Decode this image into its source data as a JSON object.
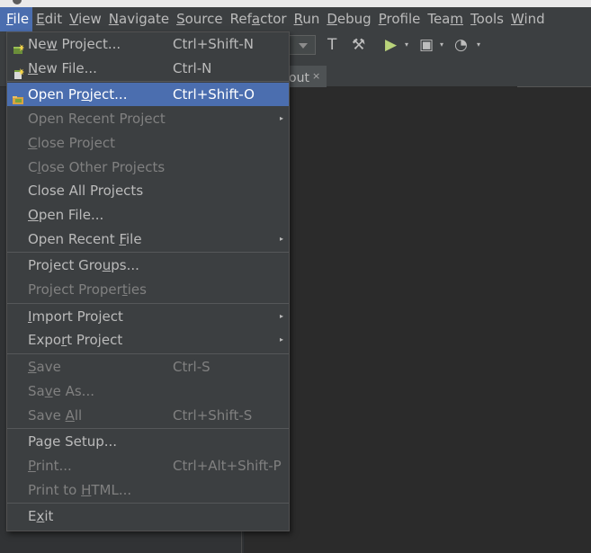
{
  "menubar": [
    {
      "label": "File",
      "m": 0,
      "active": true
    },
    {
      "label": "Edit",
      "m": 0
    },
    {
      "label": "View",
      "m": 0
    },
    {
      "label": "Navigate",
      "m": 0
    },
    {
      "label": "Source",
      "m": 0
    },
    {
      "label": "Refactor",
      "m": 3
    },
    {
      "label": "Run",
      "m": 0
    },
    {
      "label": "Debug",
      "m": 0
    },
    {
      "label": "Profile",
      "m": 0
    },
    {
      "label": "Team",
      "m": 3
    },
    {
      "label": "Tools",
      "m": 0
    },
    {
      "label": "Wind",
      "m": 0
    }
  ],
  "tab": {
    "label": "out",
    "close": "×"
  },
  "file_menu": [
    {
      "label": "New Project...",
      "m": 2,
      "shortcut": "Ctrl+Shift-N",
      "icon": "new-project-icon",
      "enabled": true
    },
    {
      "label": "New File...",
      "m": 0,
      "shortcut": "Ctrl-N",
      "icon": "new-file-icon",
      "enabled": true
    },
    {
      "sep": true
    },
    {
      "label": "Open Project...",
      "m": 7,
      "shortcut": "Ctrl+Shift-O",
      "icon": "open-project-icon",
      "enabled": true,
      "selected": true
    },
    {
      "label": "Open Recent Project",
      "m": -1,
      "submenu": true,
      "enabled": false
    },
    {
      "label": "Close Project",
      "m": 0,
      "enabled": false
    },
    {
      "label": "Close Other Projects",
      "m": 1,
      "enabled": false
    },
    {
      "label": "Close All Projects",
      "m": -1,
      "enabled": true
    },
    {
      "label": "Open File...",
      "m": 0,
      "enabled": true
    },
    {
      "label": "Open Recent File",
      "m": 12,
      "submenu": true,
      "enabled": true
    },
    {
      "sep": true
    },
    {
      "label": "Project Groups...",
      "m": 11,
      "enabled": true
    },
    {
      "label": "Project Properties",
      "m": 14,
      "enabled": false
    },
    {
      "sep": true
    },
    {
      "label": "Import Project",
      "m": 0,
      "submenu": true,
      "enabled": true
    },
    {
      "label": "Export Project",
      "m": 4,
      "submenu": true,
      "enabled": true
    },
    {
      "sep": true
    },
    {
      "label": "Save",
      "m": 0,
      "shortcut": "Ctrl-S",
      "enabled": false
    },
    {
      "label": "Save As...",
      "m": 2,
      "enabled": false
    },
    {
      "label": "Save All",
      "m": 5,
      "shortcut": "Ctrl+Shift-S",
      "enabled": false
    },
    {
      "sep": true
    },
    {
      "label": "Page Setup...",
      "m": -1,
      "enabled": true
    },
    {
      "label": "Print...",
      "m": 0,
      "shortcut": "Ctrl+Alt+Shift-P",
      "enabled": false
    },
    {
      "label": "Print to HTML...",
      "m": 9,
      "enabled": false
    },
    {
      "sep": true
    },
    {
      "label": "Exit",
      "m": 1,
      "enabled": true
    }
  ],
  "toolbar_icons": [
    "hammer-icon",
    "clean-build-icon",
    "run-icon",
    "debug-icon",
    "profile-icon"
  ],
  "colors": {
    "selection": "#4b6eaf",
    "menu_bg": "#3c3f41",
    "editor_bg": "#2b2b2b"
  }
}
